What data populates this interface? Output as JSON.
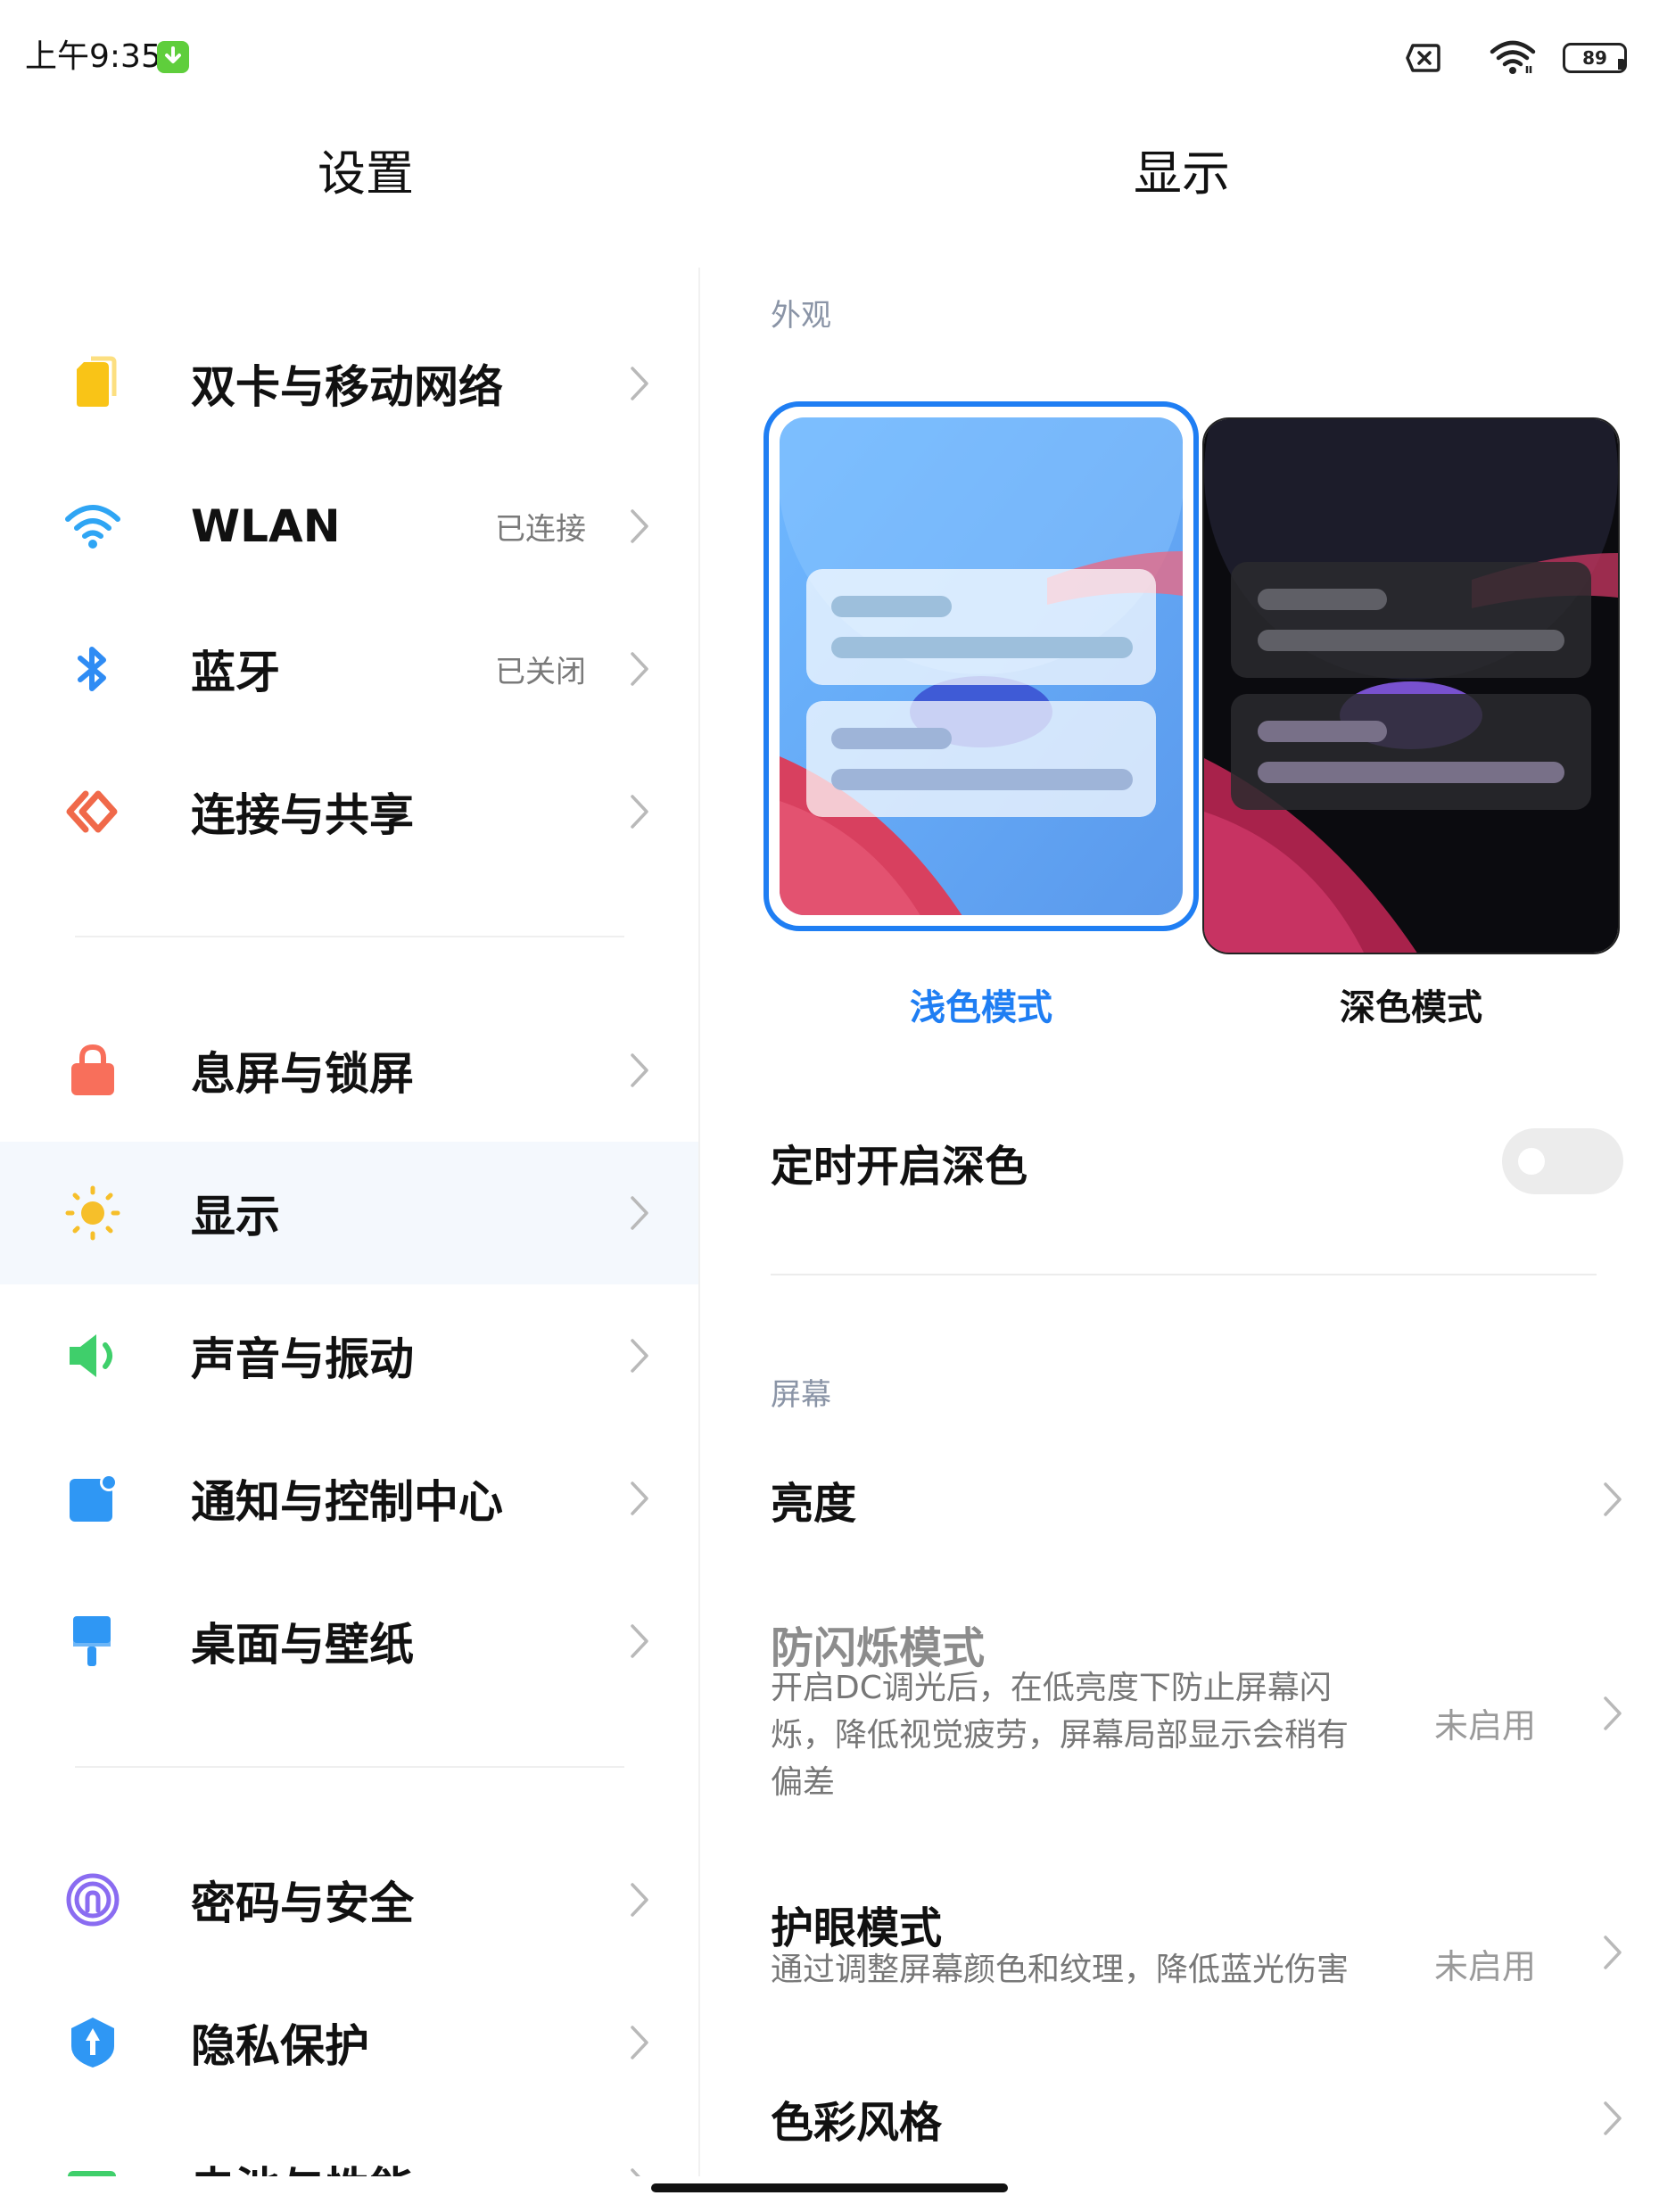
{
  "status_bar": {
    "time": "上午9:35",
    "battery": "89"
  },
  "left_panel": {
    "title": "设置",
    "groups": [
      [
        {
          "label": "双卡与移动网络",
          "status": "",
          "icon": "sim-card-icon",
          "color": "#f9c417"
        },
        {
          "label": "WLAN",
          "status": "已连接",
          "icon": "wifi-icon",
          "color": "#2fa5f4"
        },
        {
          "label": "蓝牙",
          "status": "已关闭",
          "icon": "bluetooth-icon",
          "color": "#2f8cf4"
        },
        {
          "label": "连接与共享",
          "status": "",
          "icon": "share-icon",
          "color": "#f0694a"
        }
      ],
      [
        {
          "label": "息屏与锁屏",
          "status": "",
          "icon": "lock-icon",
          "color": "#f86f5b"
        },
        {
          "label": "显示",
          "status": "",
          "icon": "sun-icon",
          "color": "#f6bf2a"
        },
        {
          "label": "声音与振动",
          "status": "",
          "icon": "speaker-icon",
          "color": "#3fcf6b"
        },
        {
          "label": "通知与控制中心",
          "status": "",
          "icon": "notification-icon",
          "color": "#2f97f4"
        },
        {
          "label": "桌面与壁纸",
          "status": "",
          "icon": "brush-icon",
          "color": "#2f97f4"
        }
      ],
      [
        {
          "label": "密码与安全",
          "status": "",
          "icon": "fingerprint-icon",
          "color": "#8a6cf1"
        },
        {
          "label": "隐私保护",
          "status": "",
          "icon": "shield-icon",
          "color": "#2f97f4"
        },
        {
          "label": "电池与性能",
          "status": "",
          "icon": "battery-icon",
          "color": "#3fcf6b"
        }
      ]
    ]
  },
  "right_panel": {
    "title": "显示",
    "appearance_label": "外观",
    "light_mode_label": "浅色模式",
    "dark_mode_label": "深色模式",
    "schedule_dark": {
      "label": "定时开启深色",
      "enabled": false
    },
    "screen_label": "屏幕",
    "brightness": {
      "label": "亮度"
    },
    "flicker": {
      "label": "防闪烁模式",
      "desc_lines": [
        "开启DC调光后，在低亮度下防止屏幕闪",
        "烁，降低视觉疲劳，屏幕局部显示会稍有",
        "偏差"
      ],
      "status": "未启用"
    },
    "eye_care": {
      "label": "护眼模式",
      "desc": "通过调整屏幕颜色和纹理，降低蓝光伤害",
      "status": "未启用"
    },
    "color_style": {
      "label": "色彩风格"
    }
  },
  "colors": {
    "accent": "#1f7ef3",
    "selected_bg": "#f4f8fd"
  }
}
